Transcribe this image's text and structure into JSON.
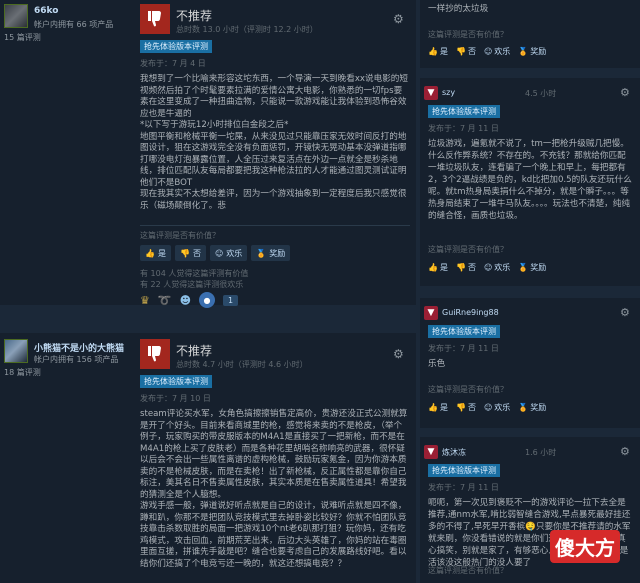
{
  "reviews": [
    {
      "author": "66ko",
      "owned": "帐户内拥有 66 项产品",
      "review_count": "15 篇评测",
      "verdict": "不推荐",
      "hours": "总时数 13.0 小时（评测时 12.2 小时）",
      "badge": "抢先体验版本评测",
      "posted": "发布于：7 月 4 日",
      "body": [
        "我想到了一个比喻来形容这坨东西，一个导演一天到晚看xx说电影的短视频然后拍了个时髦要素拉满的爱情公寓大电影，你熟悉的一切fps要素在这里变成了一种扭曲造物，只能说一款游戏能让我体验到恐怖谷效应也是牛逼的",
        "*以下写于游玩12小时排位白金段之后*",
        "地图平衡和枪械平衡一坨屎，从来没见过只能靠压家无效时间反打的地图设计，狙在这游戏完全没有负面惩罚，开镜快无晃动基本没弹道指哪打哪没电灯泡暴露位置，人全压过来复活点在外边一点就全是秒杀地线，排位匹配队友每局都要把我这种枪法拉的人才能通过图灵测试证明他们不是BOT",
        "现在我其实不太想给差评，因为一个游戏抽象到一定程度后我只感觉很乐（磁场颠倒化了。悲"
      ],
      "helpful_q": "这篇评测是否有价值？",
      "votes": [
        "是",
        "否",
        "欢乐",
        "奖励"
      ],
      "helpful_count": "有 104 人觉得这篇评测有价值",
      "funny_count": "有 22 人觉得这篇评测很欢乐",
      "award_count": "1"
    },
    {
      "author": "小熊猫不是小的大熊猫",
      "owned": "帐户内拥有 156 项产品",
      "review_count": "18 篇评测",
      "verdict": "不推荐",
      "hours": "总时数 4.7 小时（评测时 4.6 小时）",
      "badge": "抢先体验版本评测",
      "posted": "发布于：7 月 10 日",
      "body": [
        "steam评论买水军，女角色搞擦擦销售定高价，贵游还没正式公测就算是开了个好头。目前来看商城里的枪，感觉将来卖的不是枪皮，（举个例子，玩家购买的带皮服版本的M4A1是直接买了一把新枪，而不是在M4A1的枪上买了皮肤老）而是各种花里胡哨名称响亮的武器，很怀疑以后会不会出一些属性离谱的虚构枪械，鼓励玩家氪金，因为你游本质卖的不是枪械皮肤，而是在卖枪！出了新枪械，反正属性都是靠你自己标注，美其名日不售卖属性皮肤，其实本质是在售卖属性道具！希望我的猜测全是个人臆想。",
        "游戏手感一般，弹道说好听点就是自己的设计，说难听点就是四不像，蹲和趴，你那不是把团队竞技模式里去掉卧姿比较好？你就不怕团队竞技靠击杀数取胜的局面一把游戏10个nt老6趴那打狙？玩你妈，还有吃鸡模式，攻击回血，前期荒芜出来，后边大头英雄了，你妈的站在毒圈里面互搓，拼谁先手敲是吧？缝合也要考虑自己的发展路线好吧。看以结你们还搞了个电竞亏还一晚的，就这还想搞电竞？？"
      ],
      "helpful_q": "这篇评测是否有价值？"
    }
  ],
  "right": [
    {
      "snippet": "一样抄的太垃圾",
      "helpful_q": "这篇评测是否有价值？",
      "votes": [
        "是",
        "否",
        "欢乐",
        "奖励"
      ]
    },
    {
      "name": "szy",
      "hours": "4.5 小时",
      "badge": "抢先体验版本评测",
      "posted": "发布于：7 月 11 日",
      "body": "垃圾游戏，遍氪就不说了，tm一把枪升级贼几把慢。什么反作弊系统？不存在的。不充钱？那就给你匹配一堆垃圾队友，连看骗了一个晚上和早上，每把都有2，3个2逼战绩是负的，kd比把加0.5的队友还玩什么呢。就tm热身局奥捐什么不掉分，就是个瞬子。。。等热身局结束了一堆牛马队友。。。。玩法也不清楚，纯纯的缝合怪，画质也垃圾。",
      "helpful_q": "这篇评测是否有价值？",
      "votes": [
        "是",
        "否",
        "欢乐",
        "奖励"
      ]
    },
    {
      "name": "GuiRne9ing88",
      "badge": "抢先体验版本评测",
      "posted": "发布于：7 月 11 日",
      "body": "乐色",
      "helpful_q": "这篇评测是否有价值？",
      "votes": [
        "是",
        "否",
        "欢乐",
        "奖励"
      ]
    },
    {
      "name": "炼沐冻",
      "hours": "1.6 小时",
      "badge": "抢先体验版本评测",
      "posted": "发布于：7 月 11 日",
      "body": "呃呃，第一次见到褒贬不一的游戏评论一拉下去全是推荐,通nm水军,啃比弱智缝合游戏,早点暴死最好挂还多的不得了,早死早开香槟🤤只要你是不推荐请的水军就来刷，你没看错说的就是你们这些垃圾评论看了真心搞笑，别就是家了，有够恶心人的,请水军也是这是活该没这般热门的没人要了",
      "helpful_q": "这篇评测是否有价值？",
      "votes": [
        "是",
        "否",
        "欢乐",
        "奖励"
      ]
    }
  ],
  "watermark": "傻大方"
}
